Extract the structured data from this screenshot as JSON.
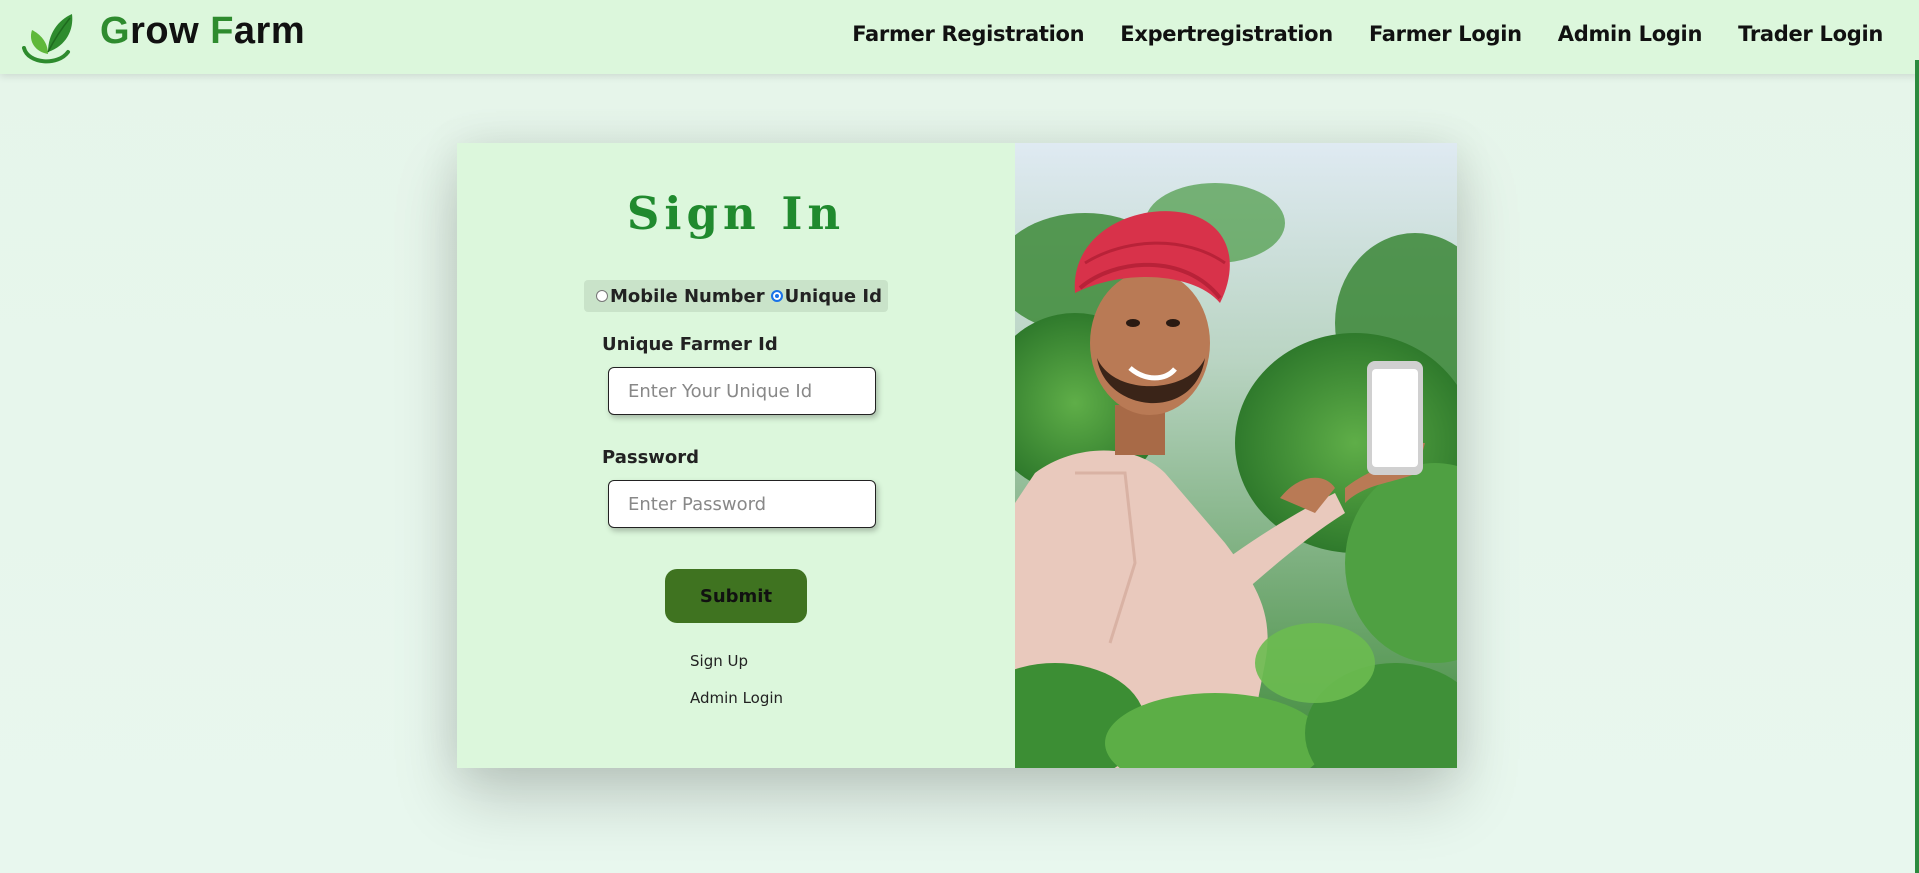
{
  "brand": {
    "first_letter": "G",
    "rest1": "row ",
    "second_letter": "F",
    "rest2": "arm"
  },
  "nav": {
    "links": [
      "Farmer Registration",
      "Expertregistration",
      "Farmer Login",
      "Admin Login",
      "Trader Login"
    ]
  },
  "form": {
    "title": "Sign In",
    "radio_options": [
      {
        "label": "Mobile Number",
        "checked": false
      },
      {
        "label": "Unique Id",
        "checked": true
      }
    ],
    "id_label": "Unique Farmer Id",
    "id_placeholder": "Enter Your Unique Id",
    "password_label": "Password",
    "password_placeholder": "Enter Password",
    "submit_label": "Submit",
    "signup_link": "Sign Up",
    "admin_link": "Admin Login"
  },
  "colors": {
    "navbar_bg": "#dcf7dc",
    "title_green": "#208a2e",
    "button_green": "#3f7320",
    "radio_blue": "#1a73e8"
  },
  "icons": {
    "logo": "leaf-logo-icon"
  }
}
